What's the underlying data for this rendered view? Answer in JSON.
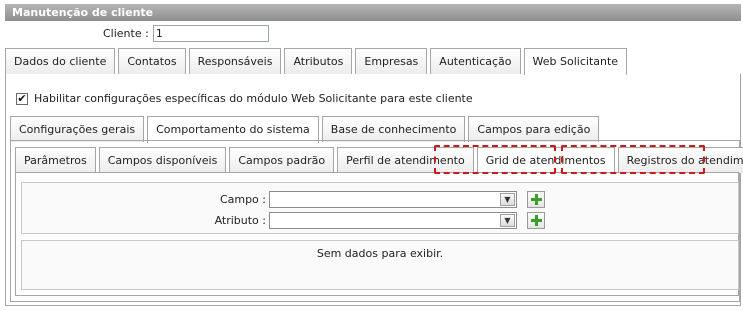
{
  "window": {
    "title": "Manutenção de cliente"
  },
  "client": {
    "label": "Cliente :",
    "value": "1"
  },
  "main_tabs": [
    {
      "label": "Dados do cliente"
    },
    {
      "label": "Contatos"
    },
    {
      "label": "Responsáveis"
    },
    {
      "label": "Atributos"
    },
    {
      "label": "Empresas"
    },
    {
      "label": "Autenticação"
    },
    {
      "label": "Web Solicitante",
      "active": true
    }
  ],
  "enable_checkbox": {
    "label": "Habilitar configurações específicas do módulo Web Solicitante para este cliente",
    "checked": true
  },
  "sub_tabs": [
    {
      "label": "Configurações gerais"
    },
    {
      "label": "Comportamento do sistema",
      "active": true
    },
    {
      "label": "Base de conhecimento"
    },
    {
      "label": "Campos para edição"
    }
  ],
  "inner_tabs": [
    {
      "label": "Parâmetros"
    },
    {
      "label": "Campos disponíveis"
    },
    {
      "label": "Campos padrão"
    },
    {
      "label": "Perfil de atendimento"
    },
    {
      "label": "Grid de atendimentos",
      "active": true
    },
    {
      "label": "Registros do atendimento"
    }
  ],
  "form": {
    "campo_label": "Campo :",
    "atributo_label": "Atributo :",
    "empty_message": "Sem dados para exibir."
  },
  "colors": {
    "highlight": "#cc1a1a",
    "add_icon": "#3aa02a",
    "title_bar": "#9e9e9e"
  }
}
